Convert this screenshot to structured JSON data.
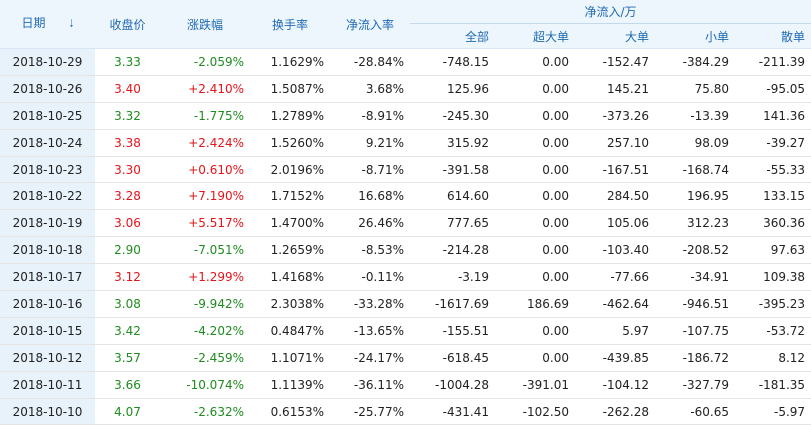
{
  "headers": {
    "date": "日期",
    "close": "收盘价",
    "change": "涨跌幅",
    "turnover": "换手率",
    "net_ratio": "净流入率",
    "net_flow_group": "净流入/万",
    "total": "全部",
    "super_large": "超大单",
    "large": "大单",
    "small": "小单",
    "retail": "散单"
  },
  "colors": {
    "up": "#e4141a",
    "down": "#1e8c1e",
    "header_text": "#1f69b5",
    "header_bg": "#eef6fd"
  },
  "rows": [
    {
      "date": "2018-10-29",
      "close": "3.33",
      "change": "-2.059%",
      "turnover": "1.1629%",
      "net_ratio": "-28.84%",
      "total": "-748.15",
      "super_large": "0.00",
      "large": "-152.47",
      "small": "-384.29",
      "retail": "-211.39",
      "dir": "down"
    },
    {
      "date": "2018-10-26",
      "close": "3.40",
      "change": "+2.410%",
      "turnover": "1.5087%",
      "net_ratio": "3.68%",
      "total": "125.96",
      "super_large": "0.00",
      "large": "145.21",
      "small": "75.80",
      "retail": "-95.05",
      "dir": "up"
    },
    {
      "date": "2018-10-25",
      "close": "3.32",
      "change": "-1.775%",
      "turnover": "1.2789%",
      "net_ratio": "-8.91%",
      "total": "-245.30",
      "super_large": "0.00",
      "large": "-373.26",
      "small": "-13.39",
      "retail": "141.36",
      "dir": "down"
    },
    {
      "date": "2018-10-24",
      "close": "3.38",
      "change": "+2.424%",
      "turnover": "1.5260%",
      "net_ratio": "9.21%",
      "total": "315.92",
      "super_large": "0.00",
      "large": "257.10",
      "small": "98.09",
      "retail": "-39.27",
      "dir": "up"
    },
    {
      "date": "2018-10-23",
      "close": "3.30",
      "change": "+0.610%",
      "turnover": "2.0196%",
      "net_ratio": "-8.71%",
      "total": "-391.58",
      "super_large": "0.00",
      "large": "-167.51",
      "small": "-168.74",
      "retail": "-55.33",
      "dir": "up"
    },
    {
      "date": "2018-10-22",
      "close": "3.28",
      "change": "+7.190%",
      "turnover": "1.7152%",
      "net_ratio": "16.68%",
      "total": "614.60",
      "super_large": "0.00",
      "large": "284.50",
      "small": "196.95",
      "retail": "133.15",
      "dir": "up"
    },
    {
      "date": "2018-10-19",
      "close": "3.06",
      "change": "+5.517%",
      "turnover": "1.4700%",
      "net_ratio": "26.46%",
      "total": "777.65",
      "super_large": "0.00",
      "large": "105.06",
      "small": "312.23",
      "retail": "360.36",
      "dir": "up"
    },
    {
      "date": "2018-10-18",
      "close": "2.90",
      "change": "-7.051%",
      "turnover": "1.2659%",
      "net_ratio": "-8.53%",
      "total": "-214.28",
      "super_large": "0.00",
      "large": "-103.40",
      "small": "-208.52",
      "retail": "97.63",
      "dir": "down"
    },
    {
      "date": "2018-10-17",
      "close": "3.12",
      "change": "+1.299%",
      "turnover": "1.4168%",
      "net_ratio": "-0.11%",
      "total": "-3.19",
      "super_large": "0.00",
      "large": "-77.66",
      "small": "-34.91",
      "retail": "109.38",
      "dir": "up"
    },
    {
      "date": "2018-10-16",
      "close": "3.08",
      "change": "-9.942%",
      "turnover": "2.3038%",
      "net_ratio": "-33.28%",
      "total": "-1617.69",
      "super_large": "186.69",
      "large": "-462.64",
      "small": "-946.51",
      "retail": "-395.23",
      "dir": "down"
    },
    {
      "date": "2018-10-15",
      "close": "3.42",
      "change": "-4.202%",
      "turnover": "0.4847%",
      "net_ratio": "-13.65%",
      "total": "-155.51",
      "super_large": "0.00",
      "large": "5.97",
      "small": "-107.75",
      "retail": "-53.72",
      "dir": "down"
    },
    {
      "date": "2018-10-12",
      "close": "3.57",
      "change": "-2.459%",
      "turnover": "1.1071%",
      "net_ratio": "-24.17%",
      "total": "-618.45",
      "super_large": "0.00",
      "large": "-439.85",
      "small": "-186.72",
      "retail": "8.12",
      "dir": "down"
    },
    {
      "date": "2018-10-11",
      "close": "3.66",
      "change": "-10.074%",
      "turnover": "1.1139%",
      "net_ratio": "-36.11%",
      "total": "-1004.28",
      "super_large": "-391.01",
      "large": "-104.12",
      "small": "-327.79",
      "retail": "-181.35",
      "dir": "down"
    },
    {
      "date": "2018-10-10",
      "close": "4.07",
      "change": "-2.632%",
      "turnover": "0.6153%",
      "net_ratio": "-25.77%",
      "total": "-431.41",
      "super_large": "-102.50",
      "large": "-262.28",
      "small": "-60.65",
      "retail": "-5.97",
      "dir": "down"
    }
  ]
}
